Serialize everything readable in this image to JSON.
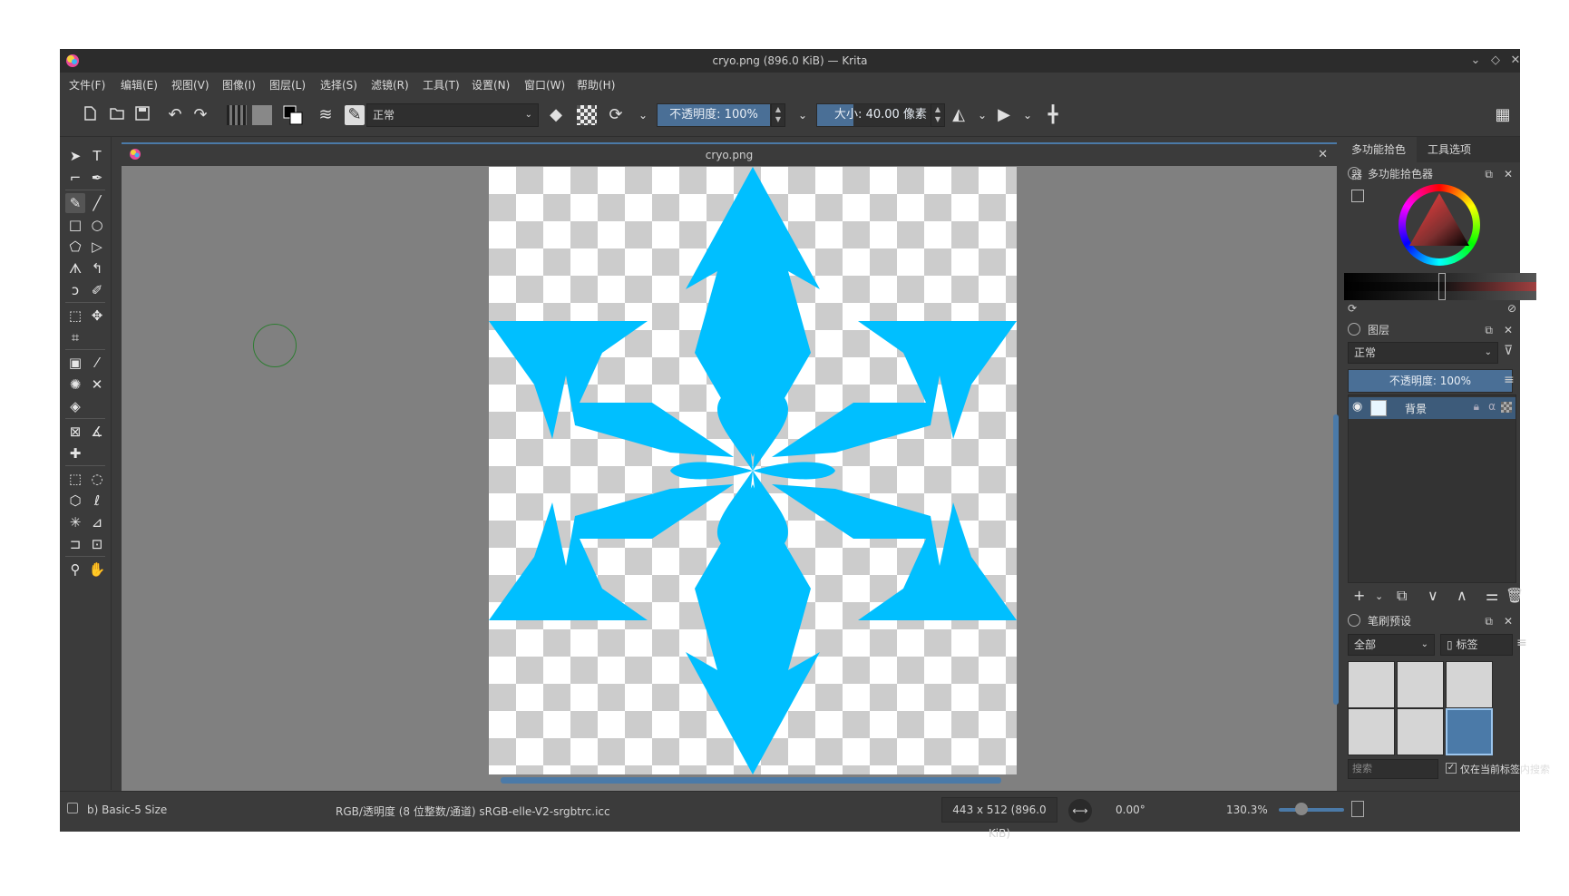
{
  "window": {
    "title": "cryo.png (896.0 KiB) — Krita"
  },
  "menu": {
    "items": [
      "文件(F)",
      "编辑(E)",
      "视图(V)",
      "图像(I)",
      "图层(L)",
      "选择(S)",
      "滤镜(R)",
      "工具(T)",
      "设置(N)",
      "窗口(W)",
      "帮助(H)"
    ]
  },
  "toolbar": {
    "blend_mode": "正常",
    "opacity_label": "不透明度: 100%",
    "size_prefix": "大小:",
    "size_value": "40.00 像素"
  },
  "document": {
    "tab_title": "cryo.png",
    "image_color": "#00bfff"
  },
  "dock": {
    "tab_color_selector": "多功能拾色器",
    "tab_tool_options": "工具选项",
    "color_selector_title": "多功能拾色器",
    "layers_title": "图层",
    "layers_blend_mode": "正常",
    "layers_opacity": "不透明度:  100%",
    "layer_name": "背景",
    "brush_presets_title": "笔刷预设",
    "brush_filter": "全部",
    "brush_tag_label": "标签",
    "brush_search_placeholder": "搜索",
    "brush_search_in_tag": "仅在当前标签内搜索"
  },
  "status": {
    "brush_name": "b) Basic-5 Size",
    "color_space": "RGB/透明度 (8 位整数/通道)  sRGB-elle-V2-srgbtrc.icc",
    "image_size": "443 x 512 (896.0 KiB)",
    "rotation": "0.00°",
    "zoom": "130.3%"
  },
  "colors": {
    "accent": "#4b7aa8",
    "panel_bg": "#3b3b3b",
    "canvas_bg": "#808080"
  }
}
